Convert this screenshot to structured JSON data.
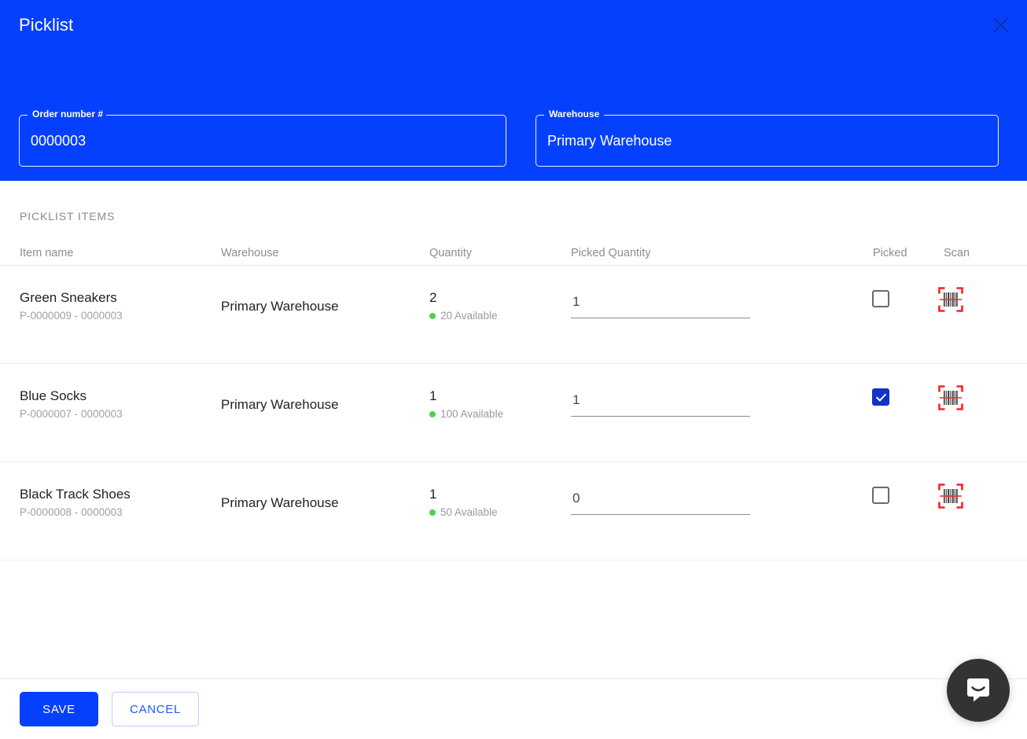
{
  "dialog": {
    "title": "Picklist",
    "close_icon": "close-icon"
  },
  "header": {
    "fields": [
      {
        "label": "Order number #",
        "value": "0000003",
        "name": "order-number"
      },
      {
        "label": "Warehouse",
        "value": "Primary Warehouse",
        "name": "warehouse"
      }
    ]
  },
  "section": {
    "title": "PICKLIST ITEMS"
  },
  "table": {
    "columns": [
      "Item name",
      "Warehouse",
      "Quantity",
      "Picked Quantity",
      "Picked",
      "Scan"
    ],
    "rows": [
      {
        "item_name": "Green Sneakers",
        "item_sub": "P-0000009 - 0000003",
        "warehouse": "Primary Warehouse",
        "quantity": "2",
        "available": "20 Available",
        "picked_quantity": "1",
        "picked": false,
        "scan_icon": "barcode-scan-icon"
      },
      {
        "item_name": "Blue Socks",
        "item_sub": "P-0000007 - 0000003",
        "warehouse": "Primary Warehouse",
        "quantity": "1",
        "available": "100 Available",
        "picked_quantity": "1",
        "picked": true,
        "scan_icon": "barcode-scan-icon"
      },
      {
        "item_name": "Black Track Shoes",
        "item_sub": "P-0000008 - 0000003",
        "warehouse": "Primary Warehouse",
        "quantity": "1",
        "available": "50 Available",
        "picked_quantity": "0",
        "picked": false,
        "scan_icon": "barcode-scan-icon"
      }
    ]
  },
  "footer": {
    "save_label": "SAVE",
    "cancel_label": "CANCEL"
  },
  "chat": {
    "icon": "intercom-chat-icon"
  },
  "colors": {
    "header_blue": "#0540ff",
    "checkbox_checked": "#1432c8",
    "available_dot_green": "#4fd14f",
    "scan_red": "#ff2020",
    "cancel_text": "#1d5cf5"
  }
}
